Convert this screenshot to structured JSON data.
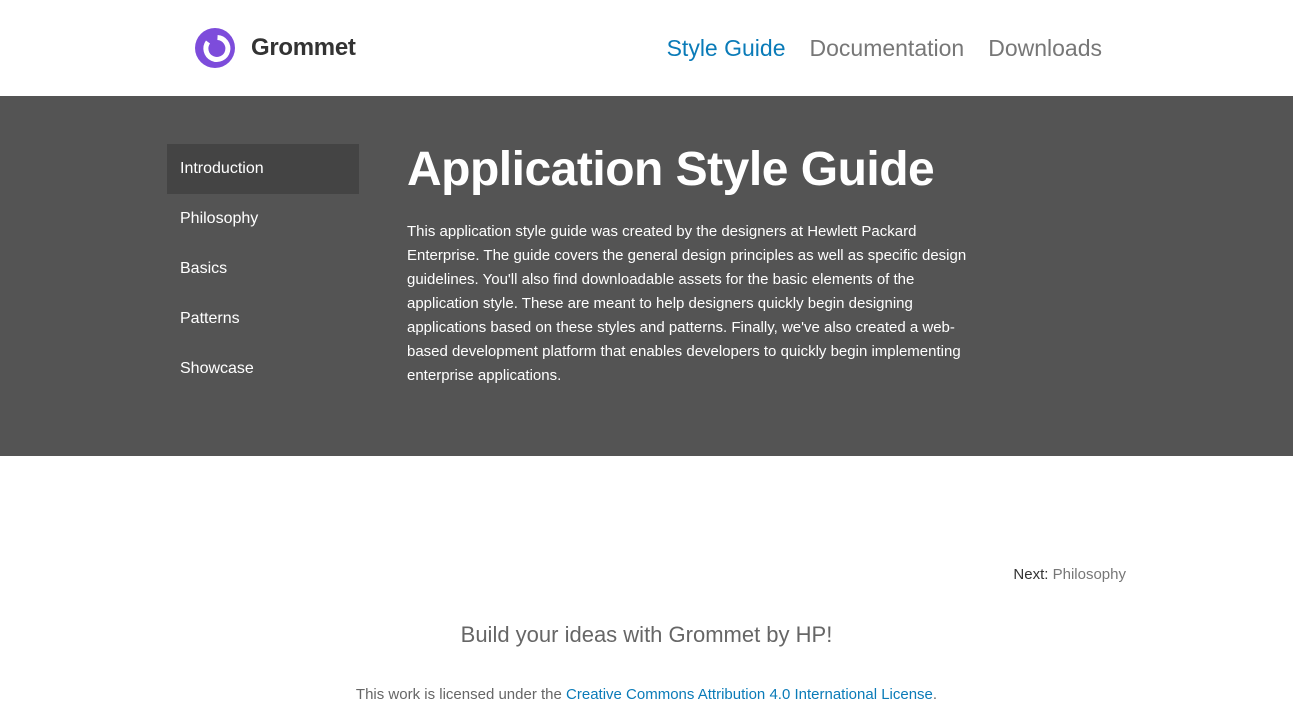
{
  "brand": {
    "name": "Grommet",
    "logo_icon": "grommet-logo-icon",
    "logo_color": "#7d4cdb"
  },
  "top_nav": {
    "items": [
      {
        "label": "Style Guide",
        "active": true
      },
      {
        "label": "Documentation",
        "active": false
      },
      {
        "label": "Downloads",
        "active": false
      }
    ],
    "active_color": "#0a7bb8"
  },
  "side_nav": {
    "items": [
      {
        "label": "Introduction",
        "active": true
      },
      {
        "label": "Philosophy",
        "active": false
      },
      {
        "label": "Basics",
        "active": false
      },
      {
        "label": "Patterns",
        "active": false
      },
      {
        "label": "Showcase",
        "active": false
      }
    ]
  },
  "hero": {
    "title": "Application Style Guide",
    "description": "This application style guide was created by the designers at Hewlett Packard Enterprise. The guide covers the general design principles as well as specific design guidelines. You'll also find downloadable assets for the basic elements of the application style. These are meant to help designers quickly begin designing applications based on these styles and patterns. Finally, we've also created a web-based development platform that enables developers to quickly begin implementing enterprise applications.",
    "background_color": "#545454"
  },
  "next": {
    "label": "Next:",
    "target": "Philosophy"
  },
  "footer": {
    "tagline": "Build your ideas with Grommet by HP!",
    "license_prefix": "This work is licensed under the",
    "license_link": "Creative Commons Attribution 4.0 International License",
    "license_suffix": "."
  }
}
